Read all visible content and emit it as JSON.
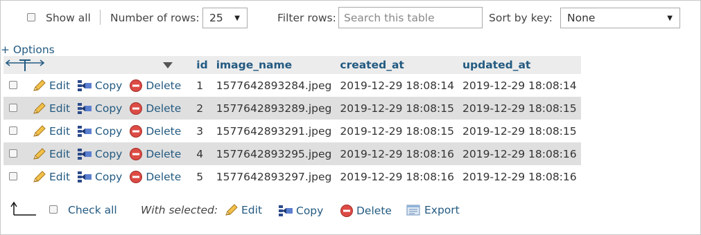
{
  "topbar": {
    "show_all": "Show all",
    "rows_label": "Number of rows:",
    "rows_value": "25",
    "filter_label": "Filter rows:",
    "filter_placeholder": "Search this table",
    "sort_label": "Sort by key:",
    "sort_value": "None"
  },
  "options_link": "+ Options",
  "columns": [
    "id",
    "image_name",
    "created_at",
    "updated_at"
  ],
  "row_actions": {
    "edit": "Edit",
    "copy": "Copy",
    "delete": "Delete"
  },
  "rows": [
    {
      "id": "1",
      "image_name": "1577642893284.jpeg",
      "created_at": "2019-12-29 18:08:14",
      "updated_at": "2019-12-29 18:08:14"
    },
    {
      "id": "2",
      "image_name": "1577642893289.jpeg",
      "created_at": "2019-12-29 18:08:15",
      "updated_at": "2019-12-29 18:08:15"
    },
    {
      "id": "3",
      "image_name": "1577642893291.jpeg",
      "created_at": "2019-12-29 18:08:15",
      "updated_at": "2019-12-29 18:08:15"
    },
    {
      "id": "4",
      "image_name": "1577642893295.jpeg",
      "created_at": "2019-12-29 18:08:16",
      "updated_at": "2019-12-29 18:08:16"
    },
    {
      "id": "5",
      "image_name": "1577642893297.jpeg",
      "created_at": "2019-12-29 18:08:16",
      "updated_at": "2019-12-29 18:08:16"
    }
  ],
  "footer": {
    "check_all": "Check all",
    "with_selected": "With selected:",
    "edit": "Edit",
    "copy": "Copy",
    "delete": "Delete",
    "export": "Export"
  },
  "colors": {
    "link": "#235a81",
    "row_alt": "#dfdfdf",
    "header_bg": "#ececec"
  }
}
